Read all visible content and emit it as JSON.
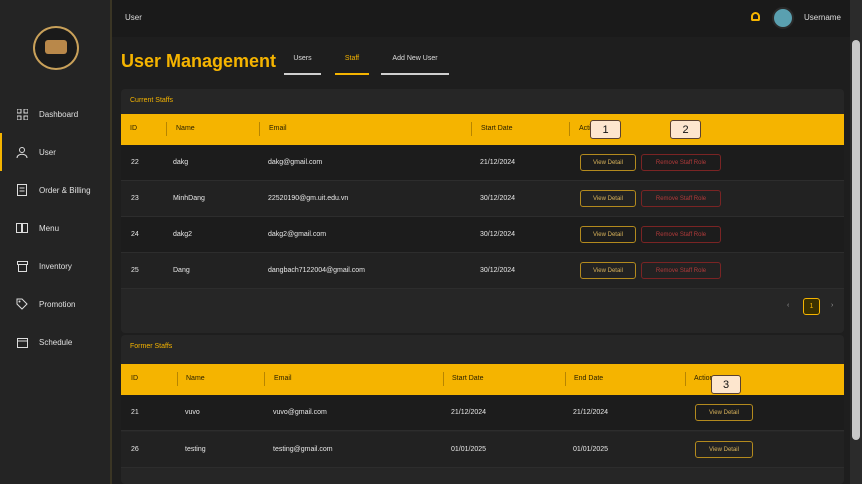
{
  "topbar": {
    "breadcrumb": "User",
    "username": "Username"
  },
  "sidebar": {
    "items": [
      {
        "label": "Dashboard",
        "icon": "grid-icon"
      },
      {
        "label": "User",
        "icon": "user-icon"
      },
      {
        "label": "Order & Billing",
        "icon": "receipt-icon"
      },
      {
        "label": "Menu",
        "icon": "book-icon"
      },
      {
        "label": "Inventory",
        "icon": "box-icon"
      },
      {
        "label": "Promotion",
        "icon": "tag-icon"
      },
      {
        "label": "Schedule",
        "icon": "calendar-icon"
      }
    ]
  },
  "header": {
    "title": "User Management",
    "tabs": [
      "Users",
      "Staff",
      "Add New User"
    ],
    "active_tab": "Staff"
  },
  "current": {
    "title": "Current Staffs",
    "columns": [
      "ID",
      "Name",
      "Email",
      "Start Date",
      "Action"
    ],
    "rows": [
      {
        "id": "22",
        "name": "dakg",
        "email": "dakg@gmail.com",
        "start": "21/12/2024"
      },
      {
        "id": "23",
        "name": "MinhDang",
        "email": "22520190@gm.uit.edu.vn",
        "start": "30/12/2024"
      },
      {
        "id": "24",
        "name": "dakg2",
        "email": "dakg2@gmail.com",
        "start": "30/12/2024"
      },
      {
        "id": "25",
        "name": "Dang",
        "email": "dangbach7122004@gmail.com",
        "start": "30/12/2024"
      }
    ],
    "view_label": "View Detail",
    "remove_label": "Remove Staff Role",
    "page": "1",
    "prev": "‹",
    "next": "›"
  },
  "former": {
    "title": "Former Staffs",
    "columns": [
      "ID",
      "Name",
      "Email",
      "Start Date",
      "End Date",
      "Action"
    ],
    "rows": [
      {
        "id": "21",
        "name": "vuvo",
        "email": "vuvo@gmail.com",
        "start": "21/12/2024",
        "end": "21/12/2024"
      },
      {
        "id": "26",
        "name": "testing",
        "email": "testing@gmail.com",
        "start": "01/01/2025",
        "end": "01/01/2025"
      }
    ],
    "view_label": "View Detail"
  },
  "badges": [
    "1",
    "2",
    "3"
  ],
  "colors": {
    "accent": "#f5b400",
    "danger": "#b03a3a",
    "background": "#1e1e1e"
  }
}
